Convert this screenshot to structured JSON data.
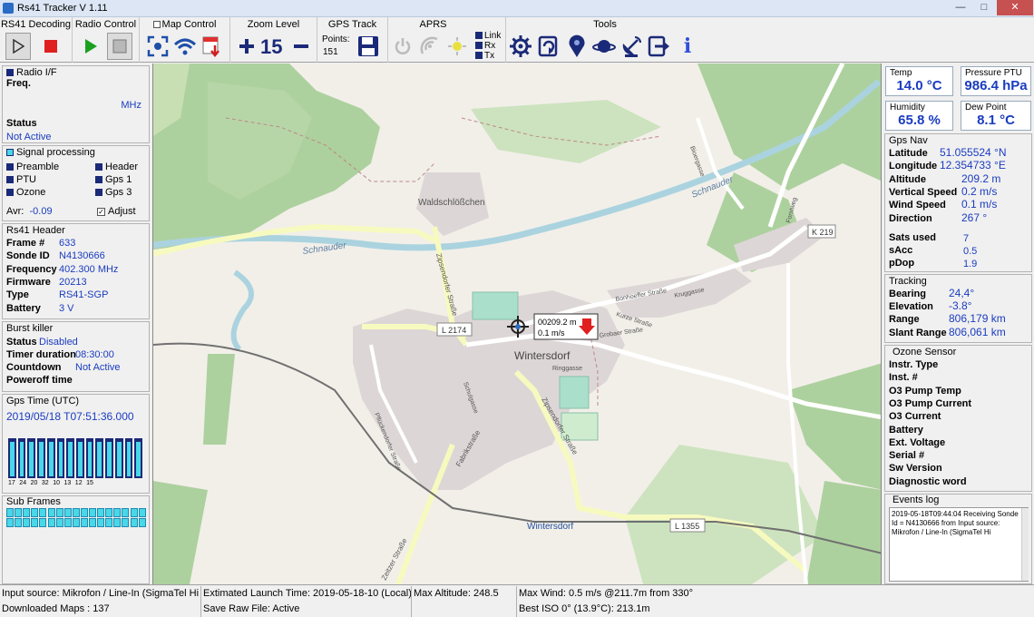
{
  "window": {
    "title": "Rs41 Tracker V 1.11"
  },
  "toolbar": {
    "rs41_decoding": "RS41 Decoding",
    "radio_control": "Radio Control",
    "map_control": "Map Control",
    "zoom_level": "Zoom Level",
    "zoom_value": "15",
    "gps_track": "GPS Track",
    "points_label": "Points:",
    "points_value": "151",
    "aprs": "APRS",
    "link": "Link",
    "rx": "Rx",
    "tx": "Tx",
    "tools": "Tools",
    "info": "i"
  },
  "radio": {
    "title": "Radio  I/F",
    "freq_label": "Freq.",
    "freq_unit": "MHz",
    "status_label": "Status",
    "status_value": "Not Active"
  },
  "signal": {
    "title": "Signal processing",
    "preamble": "Preamble",
    "header": "Header",
    "ptu": "PTU",
    "gps1": "Gps 1",
    "ozone": "Ozone",
    "gps3": "Gps 3",
    "avr_label": "Avr:",
    "avr_value": "-0.09",
    "adjust": "Adjust"
  },
  "rs41_header": {
    "title": "Rs41 Header",
    "rows": [
      {
        "label": "Frame #",
        "value": "633"
      },
      {
        "label": "Sonde ID",
        "value": "N4130666"
      },
      {
        "label": "Frequency",
        "value": "402.300 MHz"
      },
      {
        "label": "Firmware",
        "value": "20213"
      },
      {
        "label": "Type",
        "value": "RS41-SGP"
      },
      {
        "label": "Battery",
        "value": "3 V"
      }
    ]
  },
  "burst": {
    "title": "Burst killer",
    "status_label": "Status",
    "status_value": "Disabled",
    "timer_label": "Timer duration",
    "timer_value": "08:30:00",
    "countdown_label": "Countdown",
    "countdown_value": "Not Active",
    "poweroff_label": "Poweroff time"
  },
  "gps_time": {
    "title": "Gps Time (UTC)",
    "value": "2019/05/18 T07:51:36.000",
    "bar_labels": [
      "17",
      "24",
      "20",
      "32",
      "10",
      "13",
      "12",
      "15"
    ],
    "bar_levels": [
      0.95,
      0.95,
      0.95,
      0.95,
      0.95,
      0.95,
      0.95,
      0.95,
      0.95,
      0.95,
      0.95,
      0.95,
      0.95,
      0.95
    ]
  },
  "subframes": {
    "title": "Sub Frames"
  },
  "gauges": {
    "temp_label": "Temp",
    "temp_value": "14.0 °C",
    "pressure_label": "Pressure PTU",
    "pressure_value": "986.4 hPa",
    "humidity_label": "Humidity",
    "humidity_value": "65.8 %",
    "dew_label": "Dew Point",
    "dew_value": "8.1 °C"
  },
  "gps_nav": {
    "title": "Gps Nav",
    "rows": [
      {
        "label": "Latitude",
        "value": "51.055524 °N"
      },
      {
        "label": "Longitude",
        "value": "12.354733 °E"
      },
      {
        "label": "Altitude",
        "value": "209.2 m"
      },
      {
        "label": "Vertical Speed",
        "value": "0.2 m/s"
      },
      {
        "label": "Wind Speed",
        "value": "0.1 m/s"
      },
      {
        "label": "Direction",
        "value": "267 °"
      }
    ],
    "small_rows": [
      {
        "label": "Sats used",
        "value": "7"
      },
      {
        "label": "sAcc",
        "value": "0.5"
      },
      {
        "label": "pDop",
        "value": "1.9"
      }
    ]
  },
  "tracking": {
    "title": "Tracking",
    "rows": [
      {
        "label": "Bearing",
        "value": "24,4°"
      },
      {
        "label": "Elevation",
        "value": "-3.8°"
      },
      {
        "label": "Range",
        "value": "806,179 km"
      },
      {
        "label": "Slant Range",
        "value": "806,061 km"
      }
    ]
  },
  "ozone": {
    "title": "Ozone Sensor",
    "rows": [
      "Instr. Type",
      "Inst. #",
      "O3 Pump Temp",
      "O3 Pump Current",
      "O3 Current",
      "Battery",
      "Ext. Voltage",
      "Serial #",
      "Sw Version",
      "Diagnostic word"
    ]
  },
  "events": {
    "title": "Events log",
    "text": "2019-05-18T09:44:04 Receiving Sonde Id = N4130666 from Input source: Mikrofon / Line-In (SigmaTel Hi"
  },
  "map": {
    "marker_alt": "00209.2 m",
    "marker_speed": "0.1 m/s",
    "labels": {
      "waldschlosschen": "Waldschlößchen",
      "schnauder1": "Schnauder",
      "schnauder2": "Schnauder",
      "wintersdorf": "Wintersdorf",
      "wintersdorf_station": "Wintersdorf",
      "l2174": "L 2174",
      "l1355": "L 1355",
      "k219": "K 219",
      "zipsendorfer": "Zipsendorfer Straße",
      "bonhoeffer": "Bonhoeffer Straße",
      "kruggasse": "Kruggasse",
      "kurze": "Kurze Straße",
      "grobaer": "Grobaer Straße",
      "ringgasse": "Ringgasse",
      "fabrikstrasse": "Fabrikstraße",
      "pfluckendorfer": "Pflückendorfer Straße",
      "schulgasse": "Schulgasse",
      "zipsendorfer2": "Zipsendorfer Straße",
      "zeitzer": "Zeitzer Straße",
      "bioerg": "Bioergasse",
      "forstweg": "Forstweg"
    }
  },
  "status": {
    "input_source": "Input source: Mikrofon / Line-In (SigmaTel Hi",
    "downloaded": "Downloaded Maps : 137",
    "launch": "Extimated Launch Time: 2019-05-18-10 (Local)",
    "raw": "Save Raw File: Active",
    "max_alt": "Max Altitude: 248.5",
    "max_wind": "Max Wind: 0.5 m/s @211.7m from 330°",
    "best_iso": "Best ISO 0° (13.9°C): 213.1m"
  },
  "colors": {
    "accent": "#1a3cc0",
    "bar_fill": "#48d8e8",
    "bar_bg": "#1b2a78",
    "map_bg": "#f2efe9"
  }
}
